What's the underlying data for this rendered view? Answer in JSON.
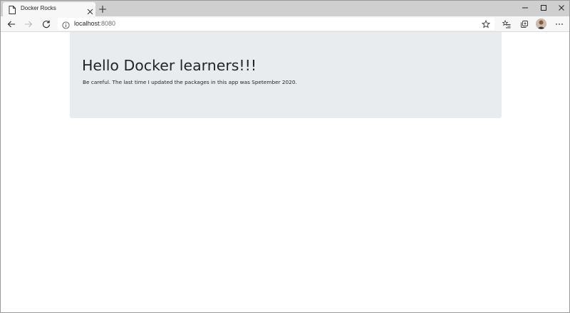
{
  "browser": {
    "tab": {
      "title": "Docker Rocks",
      "favicon": "page-icon"
    },
    "address": {
      "host": "localhost",
      "port": ":8080"
    },
    "icons": {
      "back": "back-arrow-icon",
      "forward": "forward-arrow-icon",
      "refresh": "refresh-icon",
      "favorite": "star-icon",
      "favorites_list": "favorites-list-icon",
      "collections": "collections-icon",
      "more": "more-icon"
    }
  },
  "page": {
    "heading": "Hello Docker learners!!!",
    "lead": "Be careful. The last time I updated the packages in this app was Spetember 2020.",
    "jumbotron_bg": "#e9ecef",
    "text_color": "#212529"
  }
}
